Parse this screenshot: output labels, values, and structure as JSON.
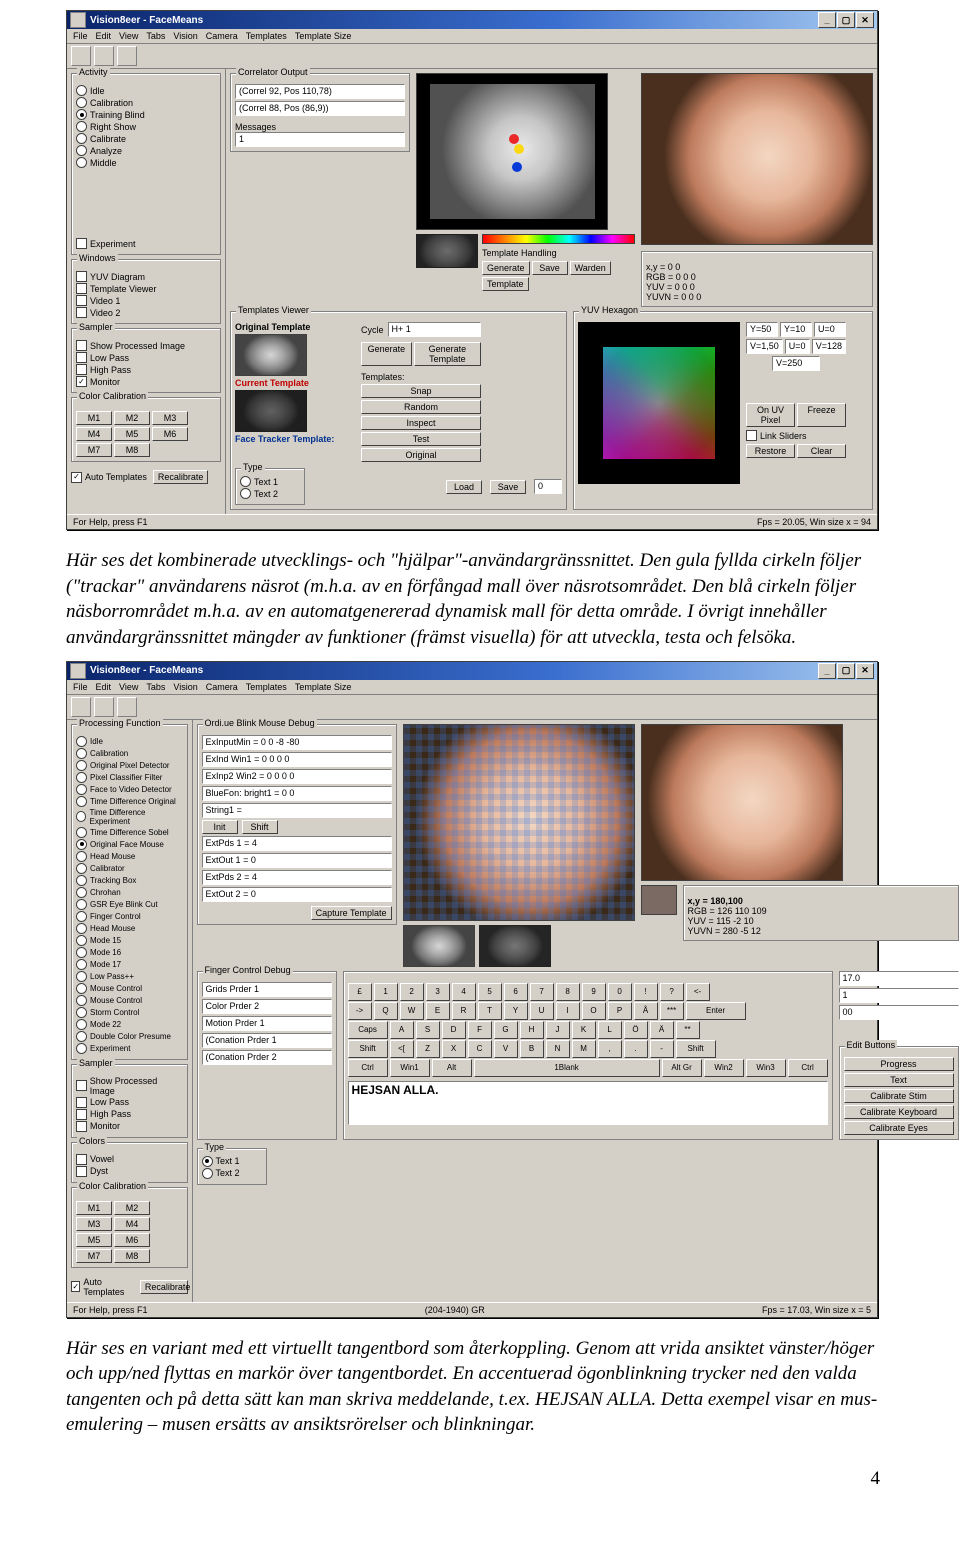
{
  "page_number": "4",
  "caption1": "Här ses det kombinerade utvecklings- och \"hjälpar\"-användargränssnittet. Den gula fyllda cirkeln följer (\"trackar\" användarens näsrot (m.h.a. av en förfångad mall över näsrotsområdet. Den blå cirkeln följer näsborrområdet m.h.a. av en automatgenererad dynamisk mall för detta område. I övrigt innehåller användargränssnittet mängder av funktioner (främst visuella) för att utveckla, testa och felsöka.",
  "caption2": "Här ses en variant med ett virtuellt tangentbord som återkoppling. Genom att vrida ansiktet vänster/höger och upp/ned flyttas en markör över tangentbordet. En accentuerad ögonblinkning trycker ned den valda tangenten och på detta sätt kan man skriva meddelande, t.ex. HEJSAN ALLA. Detta exempel visar en mus-emulering – musen ersätts av ansiktsrörelser och blinkningar.",
  "app1": {
    "title": "Vision8eer - FaceMeans",
    "menu": [
      "File",
      "Edit",
      "View",
      "Tabs",
      "Vision",
      "Camera",
      "Templates",
      "Template Size"
    ],
    "left": {
      "activity_label": "Activity",
      "activity": [
        "Idle",
        "Calibration",
        "Training Blind",
        "Right Show",
        "Calibrate",
        "Analyze",
        "Middle"
      ],
      "activity_sel": 2,
      "experiment_label": "Experiment",
      "windows_label": "Windows",
      "windows": [
        "YUV Diagram",
        "Template Viewer",
        "Video 1",
        "Video 2"
      ],
      "sampler_label": "Sampler",
      "sampler": [
        "Show Processed Image",
        "Low Pass",
        "High Pass",
        "Monitor"
      ],
      "sampler_checked": [
        3
      ],
      "colorcal_label": "Color Calibration",
      "cal_btns": [
        "M1",
        "M2",
        "M3",
        "M4",
        "M5",
        "M6",
        "M7",
        "M8"
      ],
      "bottom_chk": "Auto Templates",
      "bottom_btn": "Recalibrate"
    },
    "right": {
      "correlator_label": "Correlator Output",
      "line1": "(Correl 92, Pos 110,78)",
      "line2": "(Correl 88, Pos (86,9))",
      "messages_label": "Messages",
      "messages": "1",
      "xy": "x,y = 0 0",
      "rgb": "RGB = 0 0 0",
      "yuv": "YUV = 0 0 0",
      "yuvn": "YUVN = 0 0 0",
      "tpl_label": "Template Handling",
      "tpl_btns": [
        "Generate",
        "Save",
        "Warden",
        "Template"
      ],
      "main_label": "Templates Viewer",
      "orig": "Original Template",
      "curr": "Current Template",
      "face": "Face Tracker Template:",
      "cycle": "Cycle",
      "cycle_val": "H+ 1",
      "gen_btns": [
        "Generate",
        "Generate Template",
        "Snap",
        "Random",
        "Inspect",
        "Test",
        "Original"
      ],
      "load": "Load",
      "save": "Save",
      "save_idx": "0",
      "type_label": "Type",
      "types": [
        "Text 1",
        "Text 2"
      ],
      "yuv_title": "YUV Hexagon",
      "yuv_fields": [
        "Y=50",
        "Y=10",
        "U=0",
        "V=1,50",
        "U=0",
        "V=128",
        "V=250"
      ],
      "link": "Link Sliders",
      "btn3": "On UV Pixel",
      "btn4": "Freeze",
      "btn5": "Restore",
      "btn6": "Clear"
    },
    "status_left": "For Help, press F1",
    "status_right": "Fps = 20.05, Win size x = 94"
  },
  "app2": {
    "title": "Vision8eer - FaceMeans",
    "menu": [
      "File",
      "Edit",
      "View",
      "Tabs",
      "Vision",
      "Camera",
      "Templates",
      "Template Size"
    ],
    "left": {
      "proc_label": "Processing Function",
      "proc": [
        "Idle",
        "Calibration",
        "Original Pixel Detector",
        "Pixel Classifier Filter",
        "Face to Video Detector",
        "Time Difference Original",
        "Time Difference Experiment",
        "Time Difference Sobel",
        "Original Face Mouse",
        "Head Mouse",
        "Calibrator",
        "Tracking Box",
        "Chrohan",
        "GSR Eye Blink Cut",
        "Finger Control",
        "Head Mouse",
        "Mode 15",
        "Mode 16",
        "Mode 17",
        "Low Pass++",
        "Mouse Control",
        "Mouse Control",
        "Storm Control",
        "Mode 22",
        "Double Color Presume",
        "Experiment"
      ],
      "proc_sel": 8,
      "sampler_label": "Sampler",
      "sampler": [
        "Show Processed Image",
        "Low Pass",
        "High Pass",
        "Monitor"
      ],
      "colors_label": "Colors",
      "colors": [
        "Vowel",
        "Dyst"
      ],
      "colorcal_label": "Color Calibration",
      "cal_btns": [
        "M1",
        "M2",
        "M3",
        "M4",
        "M5",
        "M6",
        "M7",
        "M8"
      ],
      "bottom_chk": "Auto Templates",
      "bottom_btn": "Recalibrate"
    },
    "mid": {
      "debug_label": "Ordi.ue Blink Mouse Debug",
      "lines": [
        "ExInputMin = 0 0 -8 -80",
        "ExInd Win1 = 0 0 0 0",
        "ExInp2 Win2 = 0 0 0 0",
        "BlueFon: bright1 = 0 0",
        "String1 =",
        "Init",
        "Shift",
        "ExtPds 1 = 4",
        "ExtOut 1 = 0",
        "ExtPds 2 = 4",
        "ExtOut 2 = 0"
      ],
      "capture_btn": "Capture Template",
      "fc_label": "Finger Control Debug",
      "fc_lines": [
        "Grids Prder 1",
        "Color Prder 2",
        "Motion Prder 1",
        "(Conation Prder 1",
        "(Conation Prder 2"
      ]
    },
    "right": {
      "xy": "x,y = 180,100",
      "rgb": "RGB = 126 110 109",
      "yuv": "YUV = 115 -2 10",
      "yuvn": "YUVN = 280 -5 12",
      "readfields": [
        "17.0",
        "1",
        "00"
      ],
      "swatch": "#7a6a63",
      "type_label": "Type",
      "types": [
        "Text 1",
        "Text 2"
      ],
      "bigtext": "HEJSAN ALLA.",
      "panel_label": "Edit Buttons",
      "btns": [
        "Progress",
        "Text",
        "Calibrate Stim",
        "Calibrate Keyboard",
        "Calibrate Eyes"
      ]
    },
    "keys_r1": [
      "£",
      "1",
      "2",
      "3",
      "4",
      "5",
      "6",
      "7",
      "8",
      "9",
      "0",
      "!",
      "?",
      "<-"
    ],
    "keys_r2": [
      "->",
      "Q",
      "W",
      "E",
      "R",
      "T",
      "Y",
      "U",
      "I",
      "O",
      "P",
      "Å",
      "***"
    ],
    "keys_r2_side": "Enter",
    "keys_r3": [
      "Caps",
      "A",
      "S",
      "D",
      "F",
      "G",
      "H",
      "J",
      "K",
      "L",
      "Ö",
      "Ä",
      "**"
    ],
    "keys_r4": [
      "Shift",
      "<[",
      "Z",
      "X",
      "C",
      "V",
      "B",
      "N",
      "M",
      ",",
      ".",
      "-",
      "Shift"
    ],
    "keys_r5": [
      "Ctrl",
      "Win1",
      "Alt",
      "1Blank",
      "Alt Gr",
      "Win2",
      "Win3",
      "Ctrl"
    ],
    "status_left": "For Help, press F1",
    "status_mid": "(204-1940) GR",
    "status_right": "Fps = 17.03, Win size x = 5"
  }
}
